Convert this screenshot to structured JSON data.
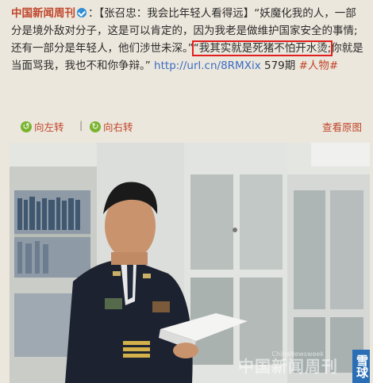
{
  "post": {
    "author": "中国新闻周刊",
    "author_separator": "：",
    "text_before": "【张召忠：我会比年轻人看得远】“妖魔化我的人，一部分是境外敌对分子，这是可以肯定的，因为我老是做维护国家安全的事情;还有一部分是年轻人，他们涉世未深。”",
    "highlight": "“我其实就是死猪不怕开水烫;",
    "text_after": "你就是当面骂我，我也不和你争辩。”",
    "link": "http://url.cn/8RMXix",
    "issue": "579期",
    "tag": "#人物#"
  },
  "actions": {
    "rotate_left": "向左转",
    "separator": "|",
    "rotate_right": "向右转",
    "view_original": "查看原图"
  },
  "photo": {
    "watermark": "中国新闻周刊",
    "watermark_small": "ChinaNewsweek",
    "badge": "雪球"
  },
  "colors": {
    "accent": "#c0462b",
    "link": "#3a6cc4",
    "highlight_border": "#e02020",
    "verify": "#2f8fd6",
    "rotate_icon": "#7ab32e"
  }
}
